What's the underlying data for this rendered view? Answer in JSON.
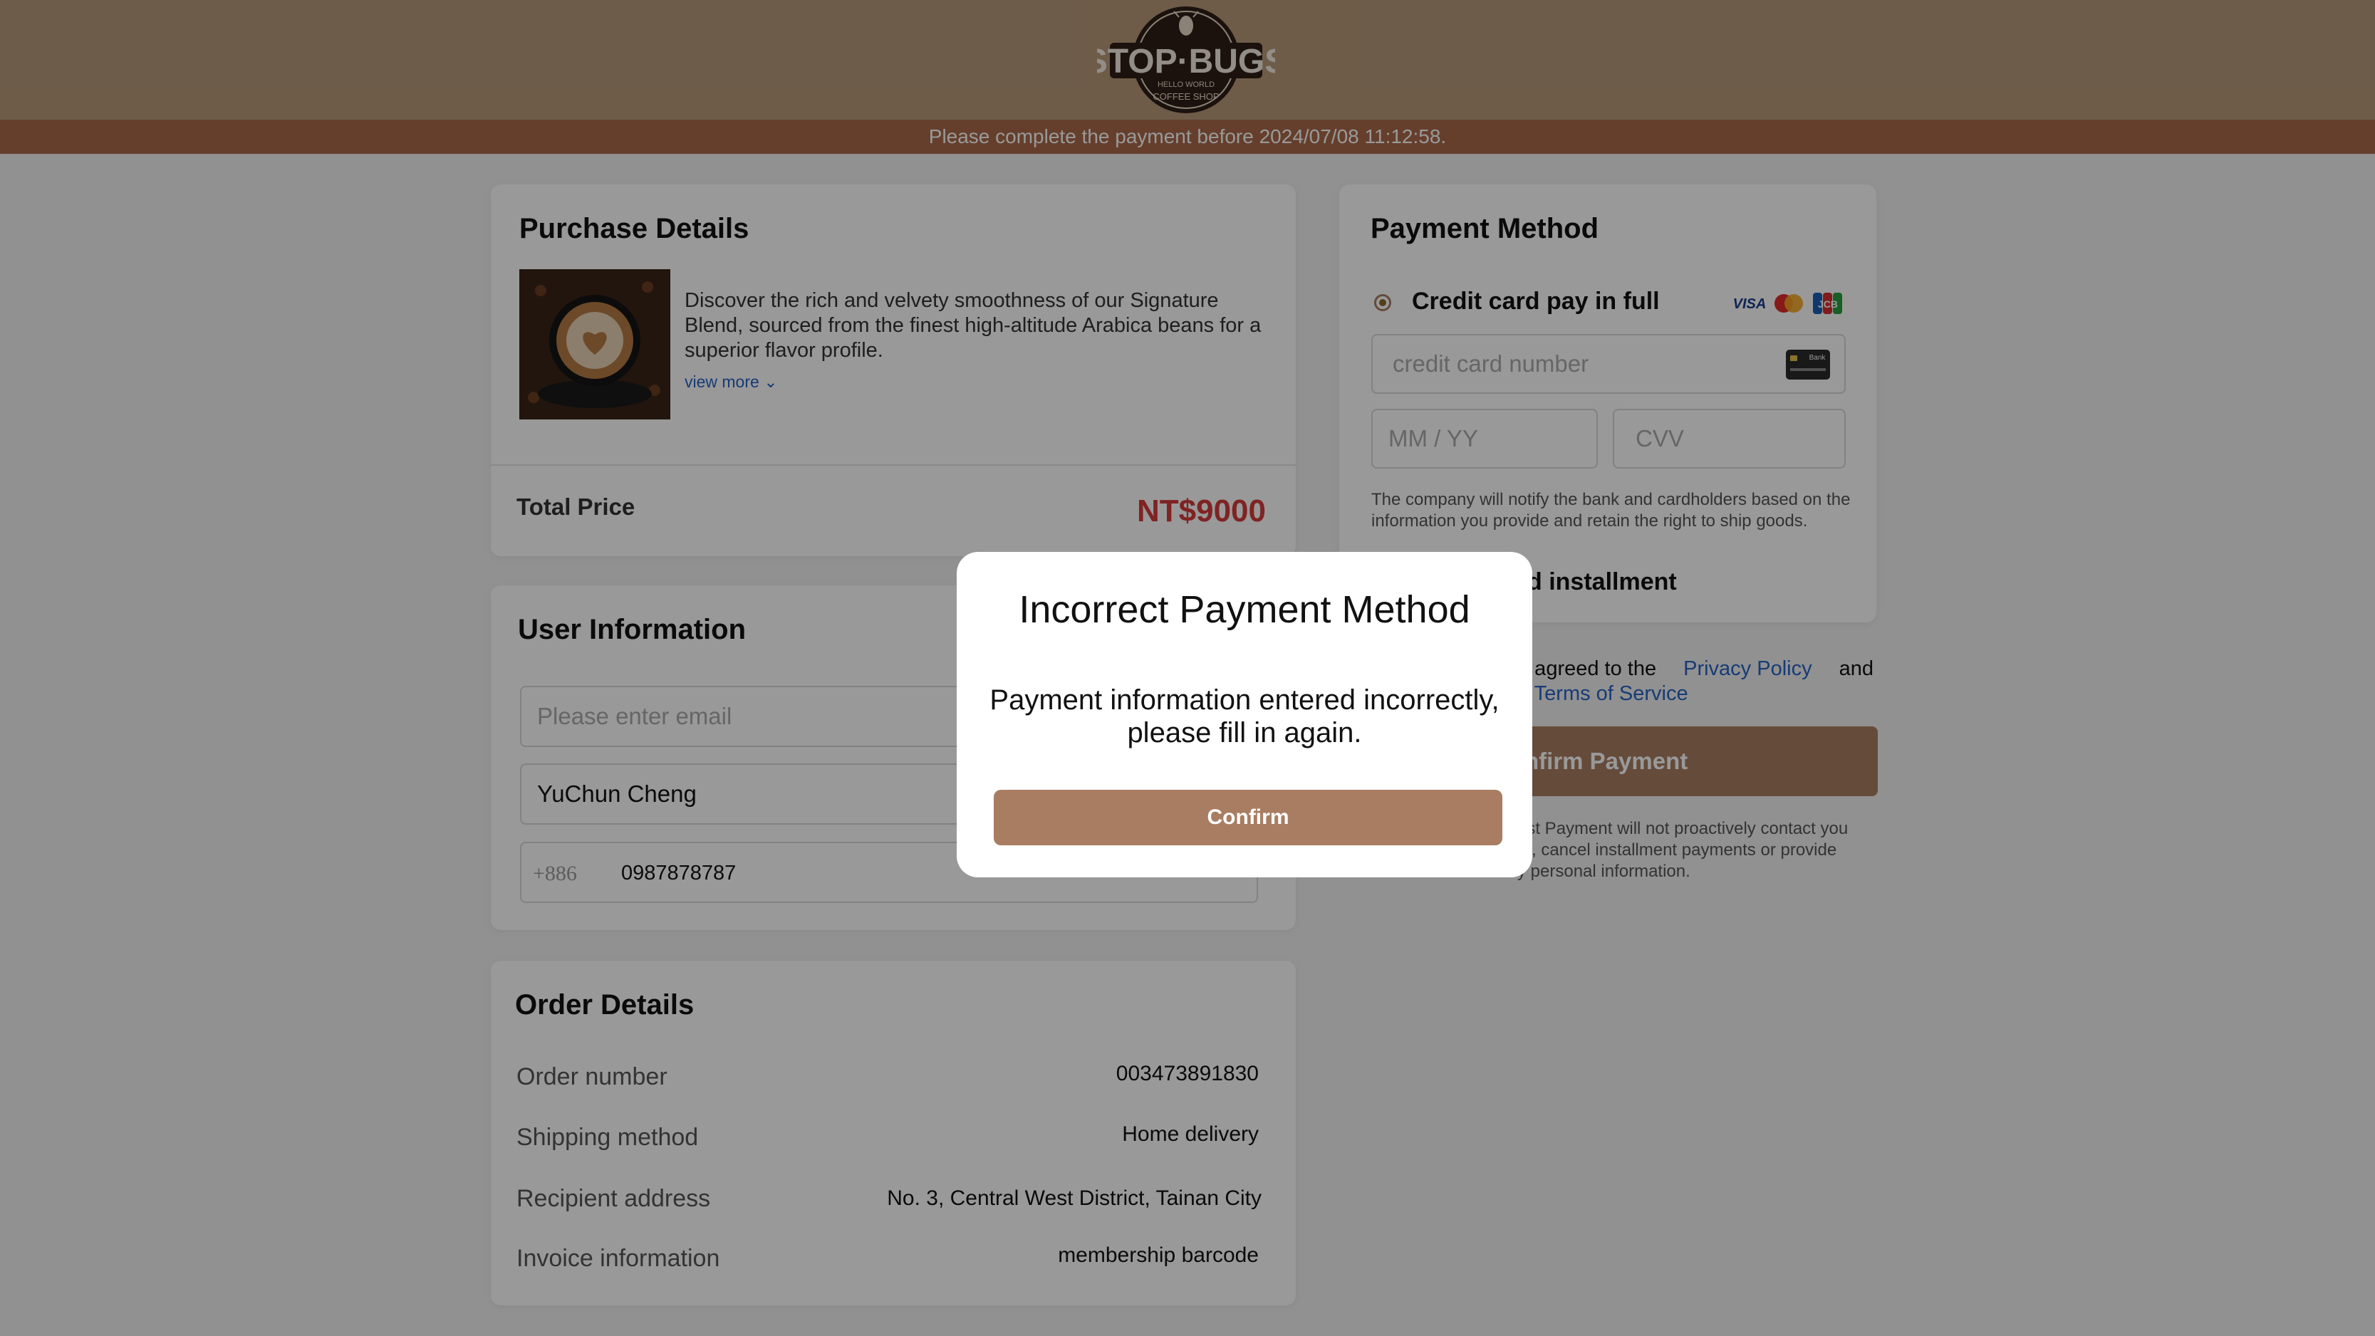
{
  "header": {
    "logo_brand": "STOP·BUGS",
    "logo_sub1": "HELLO WORLD",
    "logo_sub2": "COFFEE SHOP",
    "deadline_text": "Please complete the payment before 2024/07/08 11:12:58."
  },
  "purchase": {
    "title": "Purchase Details",
    "description": "Discover the rich and velvety smoothness of our Signature Blend, sourced from the finest high-altitude Arabica beans for a superior flavor profile.",
    "view_more": "view more",
    "total_label": "Total Price",
    "total_value": "NT$9000"
  },
  "user": {
    "title": "User Information",
    "email_placeholder": "Please enter email",
    "name_value": "YuChun Cheng",
    "phone_prefix": "+886",
    "phone_value": "0987878787"
  },
  "order": {
    "title": "Order Details",
    "rows": [
      {
        "label": "Order number",
        "value": "003473891830"
      },
      {
        "label": "Shipping method",
        "value": "Home delivery"
      },
      {
        "label": "Recipient address",
        "value": "No. 3, Central West District, Tainan City"
      },
      {
        "label": "Invoice information",
        "value": "membership barcode"
      }
    ]
  },
  "payment": {
    "title": "Payment Method",
    "option_full": "Credit card pay in full",
    "card_brands": [
      "VISA",
      "mastercard",
      "JCB"
    ],
    "card_number_placeholder": "credit card number",
    "card_icon_text": "Bank",
    "expiry_placeholder": "MM / YY",
    "cvv_placeholder": "CVV",
    "notice": "The company will notify the bank and cardholders based on the information you provide and retain the right to ship goods.",
    "option_installment_visible": "d installment",
    "agree_prefix_visible": "d agreed to the",
    "privacy_link": "Privacy Policy",
    "and_text": "and",
    "terms_visible": "n Terms of Service",
    "confirm_payment_visible": "nfirm Payment",
    "disclaimer_lines": [
      "est Payment will not proactively contact you",
      "rs, cancel installment payments or provide",
      "y personal information."
    ]
  },
  "modal": {
    "title": "Incorrect Payment Method",
    "message_line1": "Payment information entered incorrectly,",
    "message_line2": "please fill in again.",
    "button": "Confirm"
  },
  "colors": {
    "header_bg": "#b89a7b",
    "deadline_bg": "#a8694a",
    "price_red": "#d63b3b",
    "accent_brown": "#a97d62",
    "link_blue": "#2763c4"
  }
}
